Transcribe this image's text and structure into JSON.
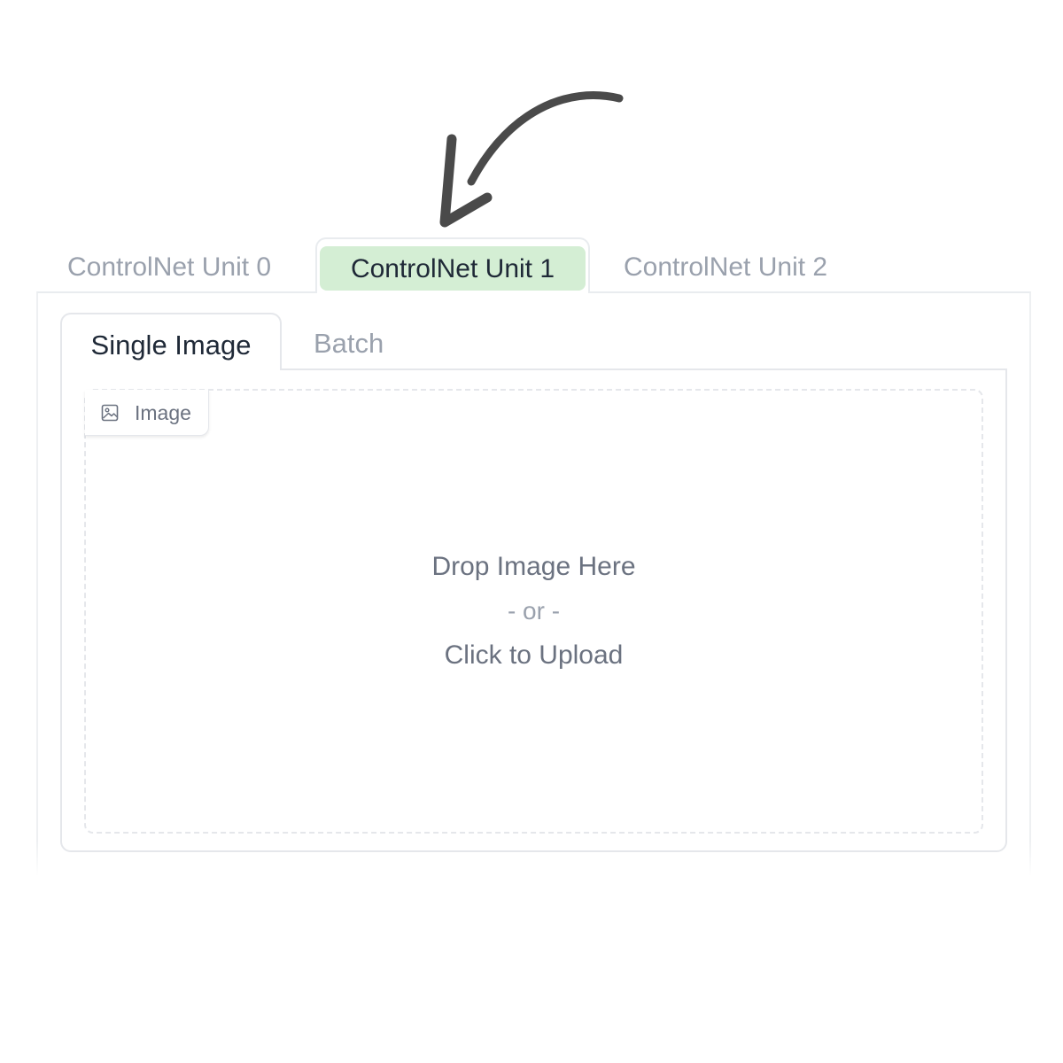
{
  "annotation": {
    "arrow_icon": "curved-arrow-pointing-down",
    "arrow_color": "#4a4a4a"
  },
  "unit_tabs": [
    {
      "label": "ControlNet Unit 0",
      "active": false
    },
    {
      "label": "ControlNet Unit 1",
      "active": true
    },
    {
      "label": "ControlNet Unit 2",
      "active": false
    }
  ],
  "mode_tabs": [
    {
      "label": "Single Image",
      "active": true
    },
    {
      "label": "Batch",
      "active": false
    }
  ],
  "image_input": {
    "label": "Image",
    "icon": "image-icon",
    "drop_text": "Drop Image Here",
    "or_text": "- or -",
    "upload_text": "Click to Upload"
  },
  "colors": {
    "active_unit_bg": "#d4eed4",
    "inactive_text": "#9aa1ad",
    "active_text": "#1f2937",
    "border": "#e5e7eb"
  }
}
